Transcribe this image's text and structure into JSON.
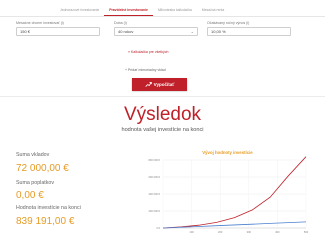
{
  "tabs": [
    {
      "label": "Jednorazové investovanie",
      "active": false
    },
    {
      "label": "Pravidelné investovanie",
      "active": true
    },
    {
      "label": "Milionárska kalkulačka",
      "active": false
    },
    {
      "label": "Mesačná renta",
      "active": false
    }
  ],
  "form": {
    "monthly_label": "Mesačne chcem investovať (i)",
    "monthly_value": "150 €",
    "duration_label": "Doba (i)",
    "duration_value": "40 rokov",
    "return_label": "Očakávaný ročný výnos (i)",
    "return_value": "10,00 %",
    "link_all_calcs": "» Kalkulačka pre všetkých",
    "link_add_monthly": "+ Pridať mimoriadny vklad",
    "submit_label": "Vypočítať"
  },
  "results": {
    "title": "Výsledok",
    "subtitle": "hodnota vašej investície na konci",
    "deposits_label": "Suma vkladov",
    "deposits_value": "72 000,00 €",
    "fees_label": "Suma poplatkov",
    "fees_value": "0,00 €",
    "final_label": "Hodnota investície na konci",
    "final_value": "839 191,00 €"
  },
  "colors": {
    "accent": "#c0202a",
    "highlight": "#e79b25",
    "series_value": "#c0202a",
    "series_deposits": "#4a7fd0"
  },
  "chart_data": {
    "type": "line",
    "title": "Vývoj hodnoty investície",
    "x_ticks": [
      "",
      "100",
      "200",
      "300",
      "400",
      "500"
    ],
    "y_ticks": [
      "0 €",
      "200 000 €",
      "400 000 €",
      "600 000 €",
      "800 000 €"
    ],
    "ylim": [
      0,
      800000
    ],
    "xlim": [
      0,
      480
    ],
    "series": [
      {
        "x": [
          0,
          60,
          120,
          180,
          240,
          300,
          360,
          420,
          480
        ],
        "values": [
          0,
          12400,
          32800,
          66400,
          121800,
          213000,
          363500,
          611000,
          839191
        ]
      },
      {
        "x": [
          0,
          60,
          120,
          180,
          240,
          300,
          360,
          420,
          480
        ],
        "values": [
          0,
          9000,
          18000,
          27000,
          36000,
          45000,
          54000,
          63000,
          72000
        ]
      }
    ],
    "grid": true,
    "legend": "none"
  }
}
